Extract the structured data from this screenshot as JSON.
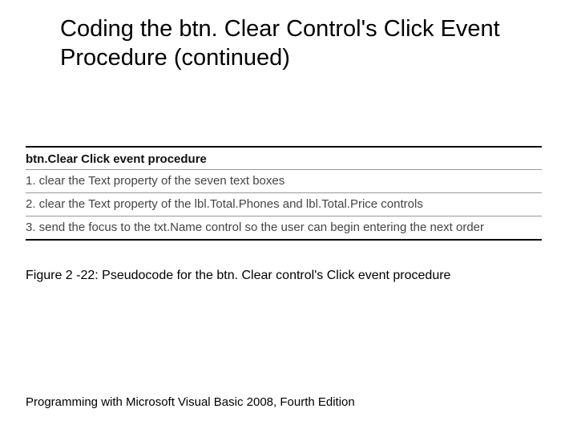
{
  "title": "Coding the btn. Clear Control's Click Event Procedure (continued)",
  "pseudocode": {
    "heading": "btn.Clear Click event procedure",
    "steps": [
      "1. clear the Text property of the seven text boxes",
      "2. clear the Text property of the lbl.Total.Phones and lbl.Total.Price controls",
      "3. send the focus to the txt.Name control so the user can begin entering the next order"
    ]
  },
  "caption": "Figure 2 -22: Pseudocode for the btn. Clear control's Click event procedure",
  "footer": "Programming with Microsoft Visual Basic 2008, Fourth Edition"
}
